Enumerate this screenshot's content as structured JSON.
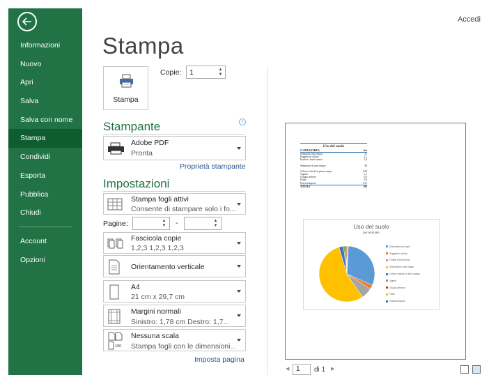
{
  "sidebar": {
    "items": [
      {
        "label": "Informazioni"
      },
      {
        "label": "Nuovo"
      },
      {
        "label": "Apri"
      },
      {
        "label": "Salva"
      },
      {
        "label": "Salva con nome"
      },
      {
        "label": "Stampa",
        "active": true
      },
      {
        "label": "Condividi"
      },
      {
        "label": "Esporta"
      },
      {
        "label": "Pubblica"
      },
      {
        "label": "Chiudi"
      }
    ],
    "bottom_items": [
      {
        "label": "Account"
      },
      {
        "label": "Opzioni"
      }
    ],
    "color": "#217346"
  },
  "header": {
    "signin": "Accedi"
  },
  "page": {
    "title": "Stampa"
  },
  "print": {
    "button_label": "Stampa",
    "copies_label": "Copie:",
    "copies_value": "1"
  },
  "printer": {
    "section_title": "Stampante",
    "name": "Adobe PDF",
    "status": "Pronta",
    "properties_link": "Proprietà stampante"
  },
  "settings": {
    "section_title": "Impostazioni",
    "what": {
      "title": "Stampa fogli attivi",
      "desc": "Consente di stampare solo i fo..."
    },
    "pages_label": "Pagine:",
    "pages_from": "",
    "pages_to": "",
    "collate": {
      "title": "Fascicola copie",
      "desc": "1,2,3    1,2,3    1,2,3"
    },
    "orientation": {
      "title": "Orientamento verticale"
    },
    "paper": {
      "title": "A4",
      "desc": "21 cm x 29,7 cm"
    },
    "margins": {
      "title": "Margini normali",
      "desc": "Sinistro: 1,78 cm   Destro: 1,7..."
    },
    "scaling": {
      "title": "Nessuna scala",
      "desc": "Stampa fogli con le dimensioni...",
      "icon_text": "100"
    },
    "page_setup_link": "Imposta pagina"
  },
  "preview": {
    "table": {
      "title": "Uso del suolo",
      "header": [
        "CATEGORIA",
        "ha"
      ],
      "rows": [
        {
          "label": "Seminativi non irrigui",
          "value": "27",
          "gap": false
        },
        {
          "label": "Poggetti in colture",
          "value": "2,2",
          "gap": false
        },
        {
          "label": "Frutteti e frutti minori",
          "value": "5,6",
          "gap": false
        },
        {
          "label": "Seminativi in aree irrigue",
          "value": "48",
          "gap": true
        },
        {
          "label": "Colture orticole in pieno campo",
          "value": "2,30",
          "gap": true
        },
        {
          "label": "Vigneti",
          "value": "1,1",
          "gap": false
        },
        {
          "label": "Gruppo arboreo",
          "value": "0,6",
          "gap": false
        },
        {
          "label": "Fiumi",
          "value": "0,6",
          "gap": false
        },
        {
          "label": "Fascia tampone",
          "value": "0,11",
          "gap": false
        }
      ],
      "total": {
        "label": "TOTALE",
        "value": "100"
      }
    },
    "nav": {
      "page_value": "1",
      "of_text": "di 1"
    }
  },
  "chart_data": {
    "type": "pie",
    "title": "Uso del suolo",
    "subtitle": "percentuale",
    "categories": [
      "Seminativi non irrigui",
      "Poggetti in colture",
      "Frutteti e frutti minori",
      "Seminativi in aree irrigue",
      "Colture orticole in pieno campo",
      "Vigneti",
      "Gruppo arboreo",
      "Fiumi",
      "Fascia tampone"
    ],
    "values": [
      27,
      2.2,
      5.6,
      48,
      2.3,
      1.1,
      0.6,
      0.6,
      0.11
    ],
    "colors": [
      "#5b9bd5",
      "#ed7d31",
      "#a5a5a5",
      "#ffc000",
      "#4472c4",
      "#70ad47",
      "#9e480e",
      "#ffc000",
      "#2e74b5"
    ],
    "legend_position": "right"
  }
}
